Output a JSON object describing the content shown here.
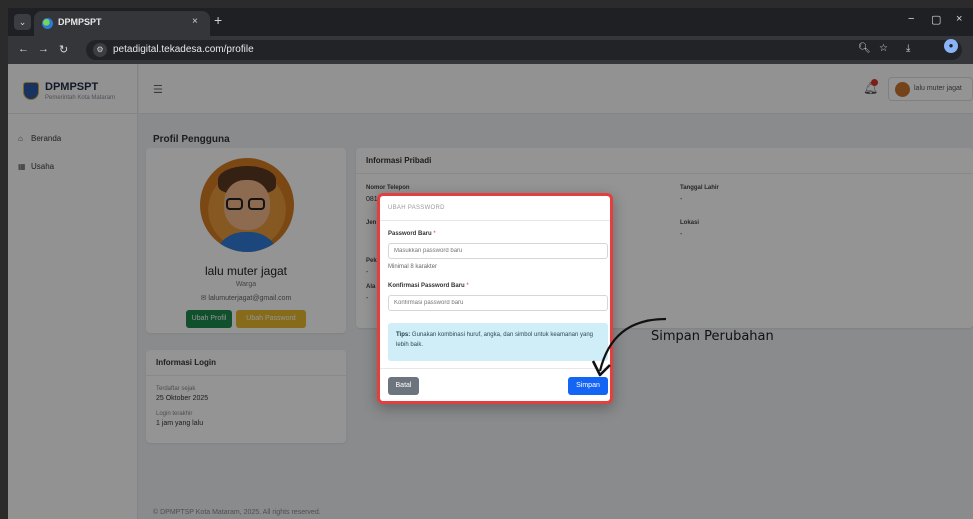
{
  "browser": {
    "tab_title": "DPMPSPT",
    "tab_close": "×",
    "new_tab": "+",
    "url": "petadigital.tekadesa.com/profile",
    "window_controls": [
      "−",
      "▢",
      "×"
    ]
  },
  "app": {
    "brand_name": "DPMPSPT",
    "brand_sub": "Pemerintah Kota Mataram",
    "sidebar": [
      {
        "label": "Beranda",
        "icon": "home-icon"
      },
      {
        "label": "Usaha",
        "icon": "building-icon"
      }
    ],
    "user_name": "lalu muter jagat"
  },
  "profile": {
    "page_title": "Profil Pengguna",
    "name": "lalu muter jagat",
    "role": "Warga",
    "email": "lalumuterjagat@gmail.com",
    "btn_edit": "Ubah Profil",
    "btn_password": "Ubah Password"
  },
  "login_info": {
    "title": "Informasi Login",
    "registered_label": "Terdaftar sejak",
    "registered_value": "25 Oktober 2025",
    "last_login_label": "Login terakhir",
    "last_login_value": "1 jam yang lalu"
  },
  "personal_info": {
    "title": "Informasi Pribadi",
    "phone_label": "Nomor Telepon",
    "phone_value": "081",
    "gender_label": "Jen",
    "job_label": "Pek",
    "job_value": "-",
    "address_label": "Ala",
    "address_value": "-",
    "dob_label": "Tanggal Lahir",
    "dob_value": "-",
    "location_label": "Lokasi",
    "location_value": "-"
  },
  "modal": {
    "title": "UBAH PASSWORD",
    "new_password_label": "Password Baru",
    "new_password_placeholder": "Masukkan password baru",
    "min_hint": "Minimal 8 karakter",
    "confirm_label": "Konfirmasi Password Baru",
    "confirm_placeholder": "Konfirmasi password baru",
    "tip_bold": "Tips:",
    "tip_text": "Gunakan kombinasi huruf, angka, dan simbol untuk keamanan yang lebih baik.",
    "btn_cancel": "Batal",
    "btn_save": "Simpan",
    "required_mark": "*"
  },
  "annotation": "Simpan Perubahan",
  "footer": "© DPMPTSP Kota Mataram, 2025. All rights reserved."
}
